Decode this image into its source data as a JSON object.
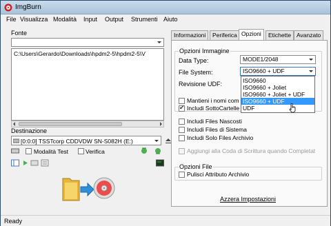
{
  "window": {
    "title": "ImgBurn"
  },
  "menu": [
    "File",
    "Visualizza",
    "Modalità",
    "Input",
    "Output",
    "Strumenti",
    "Aiuto"
  ],
  "source": {
    "label": "Fonte",
    "path": "C:\\Users\\Gerardo\\Downloads\\hpdm2-5\\hpdm2-5\\V"
  },
  "destination": {
    "label": "Destinazione",
    "drive": "[0:0:0] TSSTcorp CDDVDW SN-S082H (E:)",
    "test_mode_label": "Modalità Test",
    "test_mode_checked": false,
    "verify_label": "Verifica",
    "verify_checked": false
  },
  "tabs": [
    "Informazioni",
    "Periferica",
    "Opzioni",
    "Etichette",
    "Avanzato"
  ],
  "active_tab": "Opzioni",
  "options": {
    "group_image_label": "Opzioni Immagine",
    "data_type_label": "Data Type:",
    "data_type_value": "MODE1/2048",
    "file_system_label": "File System:",
    "file_system_value": "ISO9660 + UDF",
    "udf_revision_label": "Revisione UDF:",
    "file_system_options": [
      "ISO9660",
      "ISO9660 + Joliet",
      "ISO9660 + Joliet + UDF",
      "ISO9660 + UDF",
      "UDF"
    ],
    "file_system_highlighted": "ISO9660 + UDF",
    "keep_names_label": "Mantieni i nomi com",
    "keep_names_checked": false,
    "include_subfolders_label": "Includi SottoCartelle",
    "include_subfolders_checked": true,
    "hidden_files_label": "Includi Files Nascosti",
    "hidden_files_checked": false,
    "system_files_label": "Includi Files di Sistema",
    "system_files_checked": false,
    "archive_only_label": "Includi Solo Files Archivio",
    "archive_only_checked": false,
    "add_to_queue_label": "Aggiungi alla Coda di Scrittura quando Completat",
    "add_to_queue_checked": false,
    "group_file_label": "Opzioni File",
    "clear_archive_label": "Pulisci Attributo Archivio",
    "clear_archive_checked": false,
    "advanced_settings_link": "Azzera Impostazioni"
  },
  "status": {
    "text": "Ready"
  }
}
